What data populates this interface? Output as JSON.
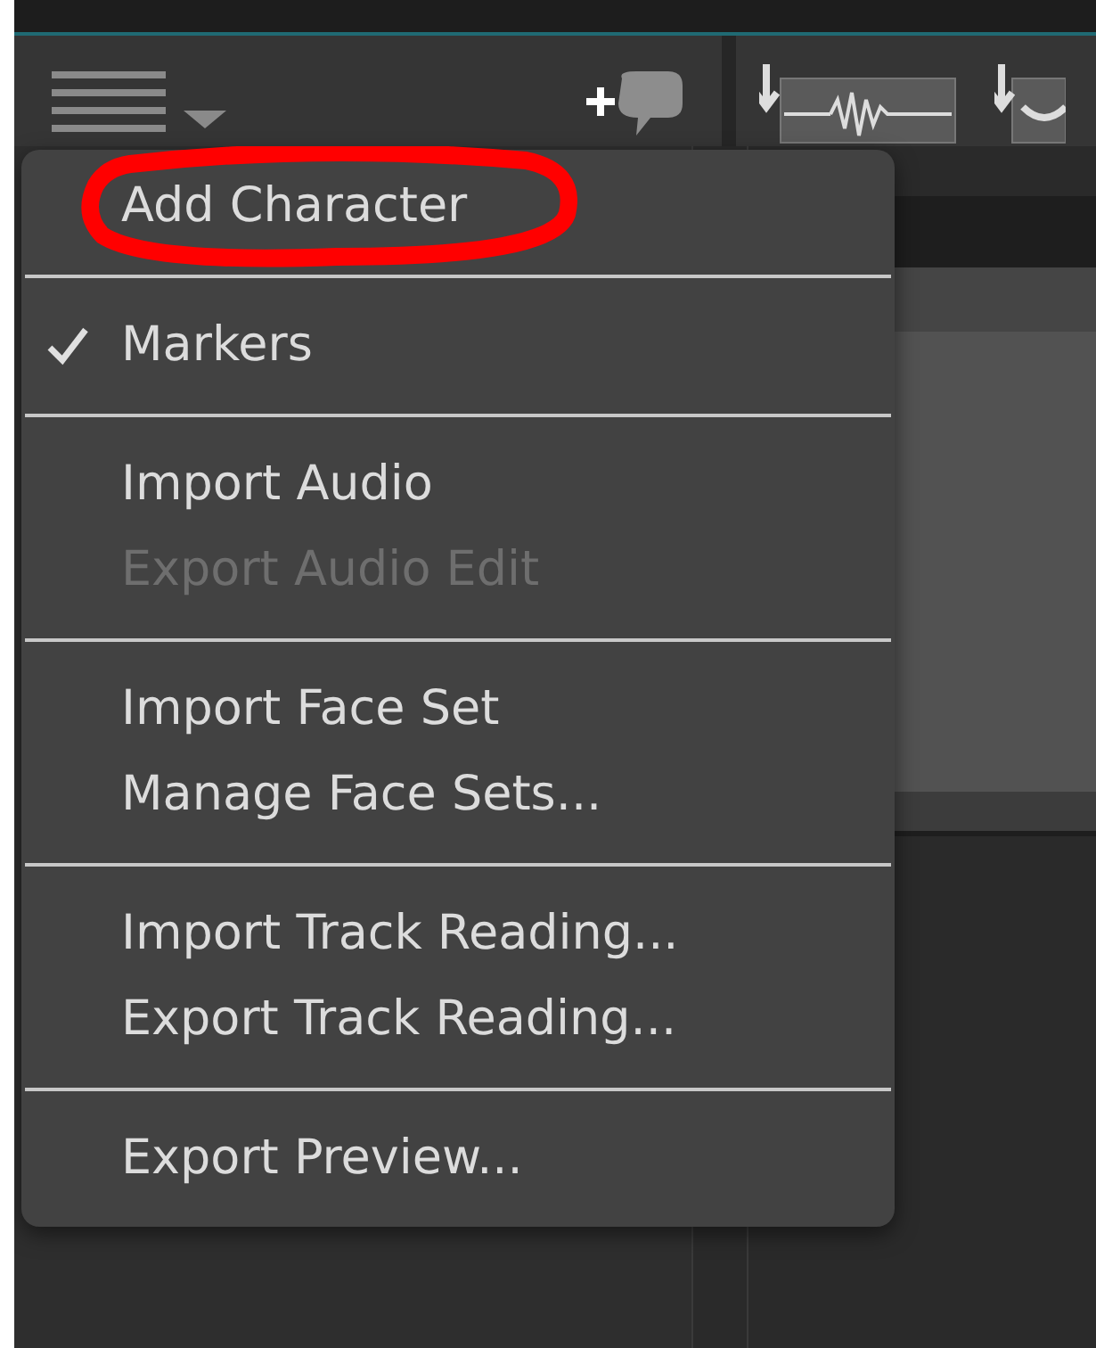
{
  "menu": {
    "groups": [
      {
        "items": [
          {
            "label": "Add Character",
            "checked": false,
            "disabled": false,
            "circled": true
          }
        ]
      },
      {
        "items": [
          {
            "label": "Markers",
            "checked": true,
            "disabled": false,
            "circled": false
          }
        ]
      },
      {
        "items": [
          {
            "label": "Import Audio",
            "checked": false,
            "disabled": false,
            "circled": false
          },
          {
            "label": "Export Audio Edit",
            "checked": false,
            "disabled": true,
            "circled": false
          }
        ]
      },
      {
        "items": [
          {
            "label": "Import Face Set",
            "checked": false,
            "disabled": false,
            "circled": false
          },
          {
            "label": "Manage Face Sets...",
            "checked": false,
            "disabled": false,
            "circled": false
          }
        ]
      },
      {
        "items": [
          {
            "label": "Import Track Reading...",
            "checked": false,
            "disabled": false,
            "circled": false
          },
          {
            "label": "Export Track Reading...",
            "checked": false,
            "disabled": false,
            "circled": false
          }
        ]
      },
      {
        "items": [
          {
            "label": "Export Preview...",
            "checked": false,
            "disabled": false,
            "circled": false
          }
        ]
      }
    ]
  }
}
